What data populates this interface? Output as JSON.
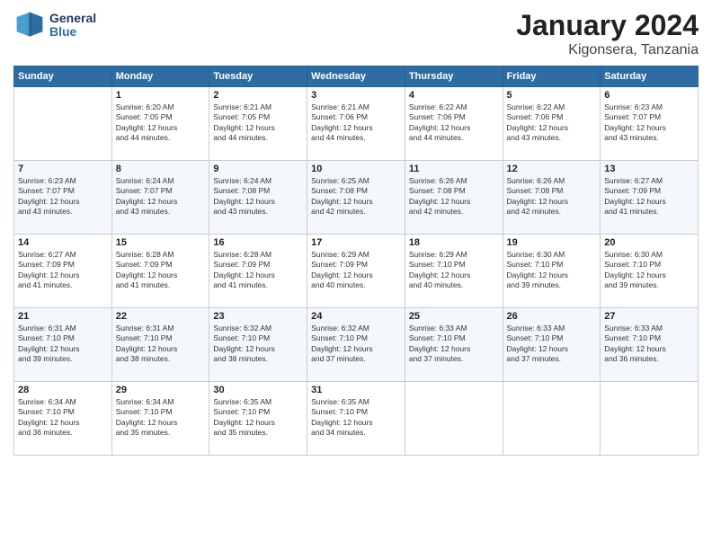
{
  "header": {
    "logo_general": "General",
    "logo_blue": "Blue",
    "month": "January 2024",
    "location": "Kigonsera, Tanzania"
  },
  "days_of_week": [
    "Sunday",
    "Monday",
    "Tuesday",
    "Wednesday",
    "Thursday",
    "Friday",
    "Saturday"
  ],
  "weeks": [
    [
      {
        "day": "",
        "info": ""
      },
      {
        "day": "1",
        "info": "Sunrise: 6:20 AM\nSunset: 7:05 PM\nDaylight: 12 hours\nand 44 minutes."
      },
      {
        "day": "2",
        "info": "Sunrise: 6:21 AM\nSunset: 7:05 PM\nDaylight: 12 hours\nand 44 minutes."
      },
      {
        "day": "3",
        "info": "Sunrise: 6:21 AM\nSunset: 7:06 PM\nDaylight: 12 hours\nand 44 minutes."
      },
      {
        "day": "4",
        "info": "Sunrise: 6:22 AM\nSunset: 7:06 PM\nDaylight: 12 hours\nand 44 minutes."
      },
      {
        "day": "5",
        "info": "Sunrise: 6:22 AM\nSunset: 7:06 PM\nDaylight: 12 hours\nand 43 minutes."
      },
      {
        "day": "6",
        "info": "Sunrise: 6:23 AM\nSunset: 7:07 PM\nDaylight: 12 hours\nand 43 minutes."
      }
    ],
    [
      {
        "day": "7",
        "info": "Sunrise: 6:23 AM\nSunset: 7:07 PM\nDaylight: 12 hours\nand 43 minutes."
      },
      {
        "day": "8",
        "info": "Sunrise: 6:24 AM\nSunset: 7:07 PM\nDaylight: 12 hours\nand 43 minutes."
      },
      {
        "day": "9",
        "info": "Sunrise: 6:24 AM\nSunset: 7:08 PM\nDaylight: 12 hours\nand 43 minutes."
      },
      {
        "day": "10",
        "info": "Sunrise: 6:25 AM\nSunset: 7:08 PM\nDaylight: 12 hours\nand 42 minutes."
      },
      {
        "day": "11",
        "info": "Sunrise: 6:26 AM\nSunset: 7:08 PM\nDaylight: 12 hours\nand 42 minutes."
      },
      {
        "day": "12",
        "info": "Sunrise: 6:26 AM\nSunset: 7:08 PM\nDaylight: 12 hours\nand 42 minutes."
      },
      {
        "day": "13",
        "info": "Sunrise: 6:27 AM\nSunset: 7:09 PM\nDaylight: 12 hours\nand 41 minutes."
      }
    ],
    [
      {
        "day": "14",
        "info": "Sunrise: 6:27 AM\nSunset: 7:09 PM\nDaylight: 12 hours\nand 41 minutes."
      },
      {
        "day": "15",
        "info": "Sunrise: 6:28 AM\nSunset: 7:09 PM\nDaylight: 12 hours\nand 41 minutes."
      },
      {
        "day": "16",
        "info": "Sunrise: 6:28 AM\nSunset: 7:09 PM\nDaylight: 12 hours\nand 41 minutes."
      },
      {
        "day": "17",
        "info": "Sunrise: 6:29 AM\nSunset: 7:09 PM\nDaylight: 12 hours\nand 40 minutes."
      },
      {
        "day": "18",
        "info": "Sunrise: 6:29 AM\nSunset: 7:10 PM\nDaylight: 12 hours\nand 40 minutes."
      },
      {
        "day": "19",
        "info": "Sunrise: 6:30 AM\nSunset: 7:10 PM\nDaylight: 12 hours\nand 39 minutes."
      },
      {
        "day": "20",
        "info": "Sunrise: 6:30 AM\nSunset: 7:10 PM\nDaylight: 12 hours\nand 39 minutes."
      }
    ],
    [
      {
        "day": "21",
        "info": "Sunrise: 6:31 AM\nSunset: 7:10 PM\nDaylight: 12 hours\nand 39 minutes."
      },
      {
        "day": "22",
        "info": "Sunrise: 6:31 AM\nSunset: 7:10 PM\nDaylight: 12 hours\nand 38 minutes."
      },
      {
        "day": "23",
        "info": "Sunrise: 6:32 AM\nSunset: 7:10 PM\nDaylight: 12 hours\nand 38 minutes."
      },
      {
        "day": "24",
        "info": "Sunrise: 6:32 AM\nSunset: 7:10 PM\nDaylight: 12 hours\nand 37 minutes."
      },
      {
        "day": "25",
        "info": "Sunrise: 6:33 AM\nSunset: 7:10 PM\nDaylight: 12 hours\nand 37 minutes."
      },
      {
        "day": "26",
        "info": "Sunrise: 6:33 AM\nSunset: 7:10 PM\nDaylight: 12 hours\nand 37 minutes."
      },
      {
        "day": "27",
        "info": "Sunrise: 6:33 AM\nSunset: 7:10 PM\nDaylight: 12 hours\nand 36 minutes."
      }
    ],
    [
      {
        "day": "28",
        "info": "Sunrise: 6:34 AM\nSunset: 7:10 PM\nDaylight: 12 hours\nand 36 minutes."
      },
      {
        "day": "29",
        "info": "Sunrise: 6:34 AM\nSunset: 7:10 PM\nDaylight: 12 hours\nand 35 minutes."
      },
      {
        "day": "30",
        "info": "Sunrise: 6:35 AM\nSunset: 7:10 PM\nDaylight: 12 hours\nand 35 minutes."
      },
      {
        "day": "31",
        "info": "Sunrise: 6:35 AM\nSunset: 7:10 PM\nDaylight: 12 hours\nand 34 minutes."
      },
      {
        "day": "",
        "info": ""
      },
      {
        "day": "",
        "info": ""
      },
      {
        "day": "",
        "info": ""
      }
    ]
  ]
}
